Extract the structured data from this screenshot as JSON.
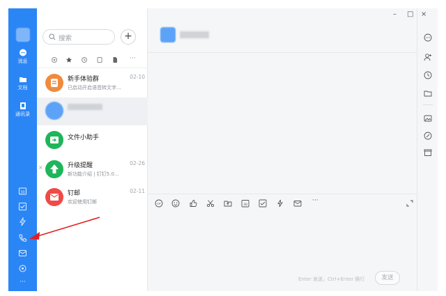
{
  "nav": {
    "messages_label": "消息",
    "docs_label": "文档",
    "contacts_label": "通讯录",
    "more": "···"
  },
  "search": {
    "placeholder": "搜索",
    "add": "+"
  },
  "filters": {
    "more": "···"
  },
  "conversations": [
    {
      "name": "新手体验群",
      "preview": "已启动开启语音转文字...",
      "time": "02-10",
      "avatar_color": "#f08a3c"
    },
    {
      "name": "",
      "preview": "",
      "time": "",
      "avatar_color": "#5ca3f8"
    },
    {
      "name": "文件小助手",
      "preview": "",
      "time": "",
      "avatar_color": "#1fb55a"
    },
    {
      "name": "升级提醒",
      "preview": "新功能介绍 | 钉钉5.0...",
      "time": "02-26",
      "avatar_color": "#1fb55a"
    },
    {
      "name": "钉邮",
      "preview": "欢迎使用钉邮",
      "time": "02-11",
      "avatar_color": "#f04a47"
    }
  ],
  "composer": {
    "hint": "Enter 发送，Ctrl+Enter 换行",
    "send_label": "发送",
    "more": "···"
  },
  "window": {
    "minimize": "–",
    "maximize": "□",
    "close": "×"
  },
  "colors": {
    "accent": "#2b86f5",
    "annotation": "#e02020"
  }
}
